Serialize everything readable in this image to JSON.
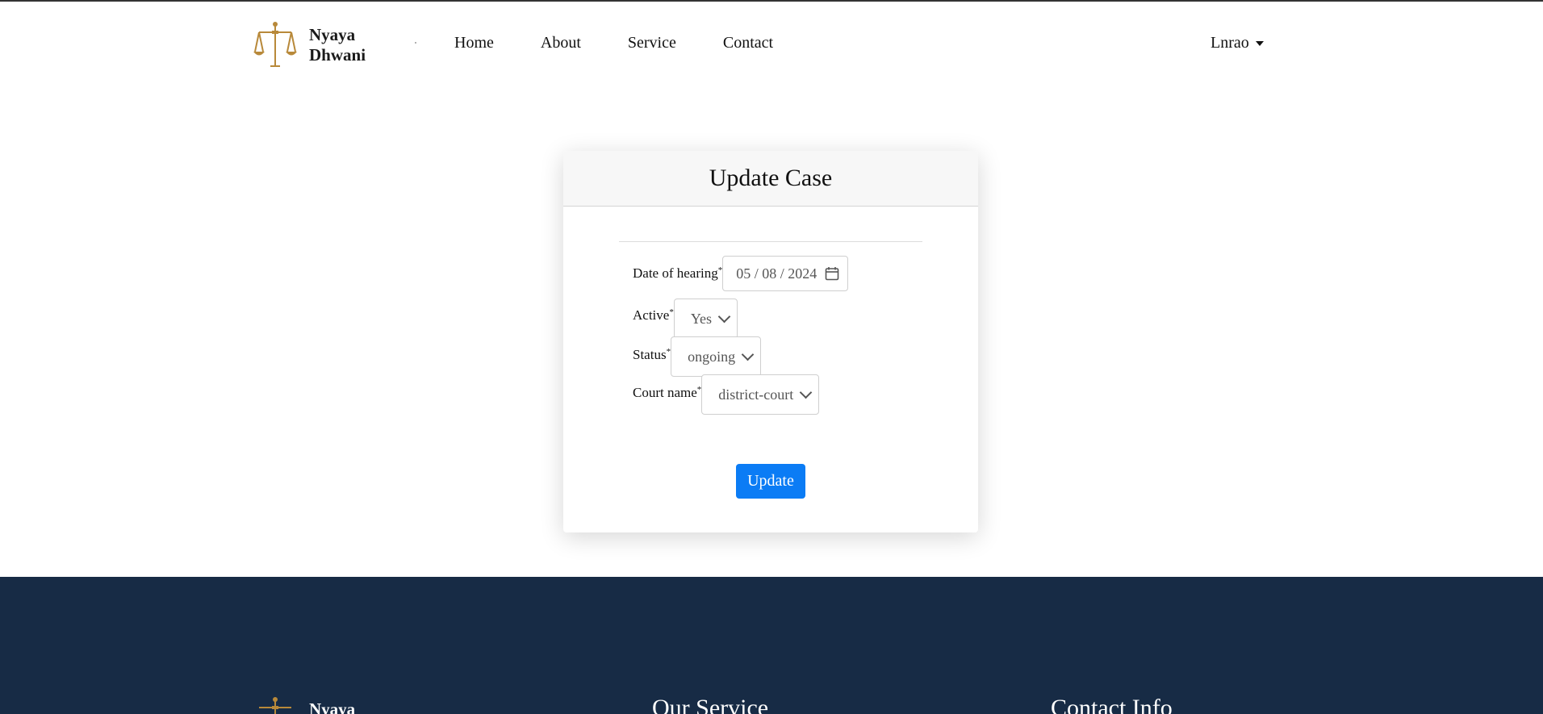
{
  "navbar": {
    "brand_line1": "Nyaya",
    "brand_line2": "Dhwani",
    "links": [
      "Home",
      "About",
      "Service",
      "Contact"
    ],
    "user": "Lnrao"
  },
  "card": {
    "title": "Update Case",
    "fields": {
      "date_label": "Date of hearing",
      "date_value": "05 / 08 / 2024",
      "active_label": "Active",
      "active_value": "Yes",
      "status_label": "Status",
      "status_value": "ongoing",
      "court_label": "Court name",
      "court_value": "district-court",
      "required_mark": "*"
    },
    "submit_label": "Update"
  },
  "footer": {
    "brand": "Nyaya",
    "service_heading": "Our Service",
    "contact_heading": "Contact Info"
  },
  "colors": {
    "accent": "#0b7cf5",
    "footer_bg": "#172b45",
    "logo_gold": "#b8893a"
  }
}
